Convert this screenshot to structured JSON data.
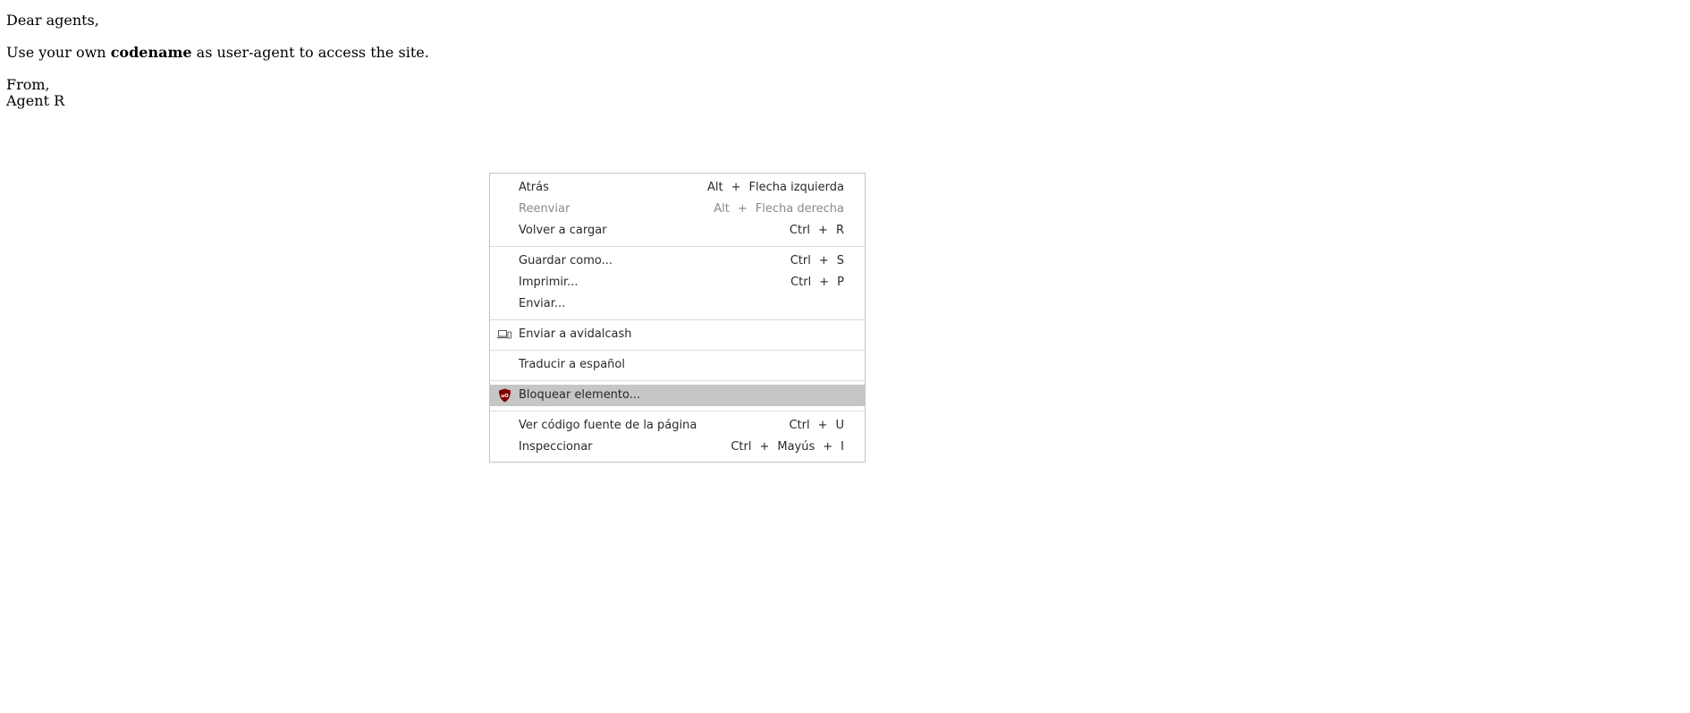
{
  "letter": {
    "greeting": "Dear agents,",
    "line_before_bold": "Use your own ",
    "bold_word": "codename",
    "line_after_bold": " as user-agent to access the site.",
    "from": "From,",
    "signature": "Agent R"
  },
  "context_menu": {
    "back": {
      "label": "Atrás",
      "keys": [
        "Alt",
        "Flecha izquierda"
      ]
    },
    "forward": {
      "label": "Reenviar",
      "keys": [
        "Alt",
        "Flecha derecha"
      ]
    },
    "reload": {
      "label": "Volver a cargar",
      "keys": [
        "Ctrl",
        "R"
      ]
    },
    "save_as": {
      "label": "Guardar como...",
      "keys": [
        "Ctrl",
        "S"
      ]
    },
    "print": {
      "label": "Imprimir...",
      "keys": [
        "Ctrl",
        "P"
      ]
    },
    "send": {
      "label": "Enviar..."
    },
    "send_to_device": {
      "label": "Enviar a avidalcash",
      "icon": "devices-icon"
    },
    "translate": {
      "label": "Traducir a español"
    },
    "block_element": {
      "label": "Bloquear elemento...",
      "icon": "ublock-origin-icon",
      "accent": "#800000"
    },
    "view_source": {
      "label": "Ver código fuente de la página",
      "keys": [
        "Ctrl",
        "U"
      ]
    },
    "inspect": {
      "label": "Inspeccionar",
      "keys": [
        "Ctrl",
        "Mayús",
        "I"
      ]
    }
  }
}
